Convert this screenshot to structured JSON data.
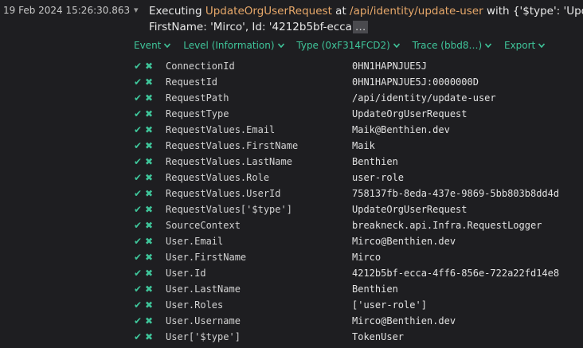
{
  "event": {
    "timestamp": "19 Feb 2024  15:26:30.863",
    "message_prefix": "Executing ",
    "message_type": "UpdateOrgUserRequest",
    "message_mid": " at ",
    "message_path": "/api/identity/update-user",
    "message_suffix": " with {'$type': 'UpdateOrgU",
    "message_line2": "FirstName: 'Mirco', Id: '4212b5bf-ecca",
    "ellipsis": "…"
  },
  "toolbar": {
    "event_label": "Event",
    "level_label": "Level (Information)",
    "type_label": "Type (0xF314FCD2)",
    "trace_label": "Trace (bbd8…)",
    "export_label": "Export"
  },
  "properties": [
    {
      "key": "ConnectionId",
      "value": "0HN1HAPNJUE5J"
    },
    {
      "key": "RequestId",
      "value": "0HN1HAPNJUE5J:0000000D"
    },
    {
      "key": "RequestPath",
      "value": "/api/identity/update-user"
    },
    {
      "key": "RequestType",
      "value": "UpdateOrgUserRequest"
    },
    {
      "key": "RequestValues.Email",
      "value": "Maik@Benthien.dev"
    },
    {
      "key": "RequestValues.FirstName",
      "value": "Maik"
    },
    {
      "key": "RequestValues.LastName",
      "value": "Benthien"
    },
    {
      "key": "RequestValues.Role",
      "value": "user-role"
    },
    {
      "key": "RequestValues.UserId",
      "value": "758137fb-8eda-437e-9869-5bb803b8dd4d"
    },
    {
      "key": "RequestValues['$type']",
      "value": "UpdateOrgUserRequest"
    },
    {
      "key": "SourceContext",
      "value": "breakneck.api.Infra.RequestLogger"
    },
    {
      "key": "User.Email",
      "value": "Mirco@Benthien.dev"
    },
    {
      "key": "User.FirstName",
      "value": "Mirco"
    },
    {
      "key": "User.Id",
      "value": "4212b5bf-ecca-4ff6-856e-722a22fd14e8"
    },
    {
      "key": "User.LastName",
      "value": "Benthien"
    },
    {
      "key": "User.Roles",
      "value": "['user-role']"
    },
    {
      "key": "User.Username",
      "value": "Mirco@Benthien.dev"
    },
    {
      "key": "User['$type']",
      "value": "TokenUser"
    }
  ],
  "icons": {
    "include": "check-icon",
    "exclude": "x-icon",
    "dropdown": "chevron-down-icon",
    "expander": "triangle-down-icon"
  },
  "colors": {
    "background": "#1e1e21",
    "accent": "#3fc59a",
    "highlight": "#e7a86a"
  }
}
